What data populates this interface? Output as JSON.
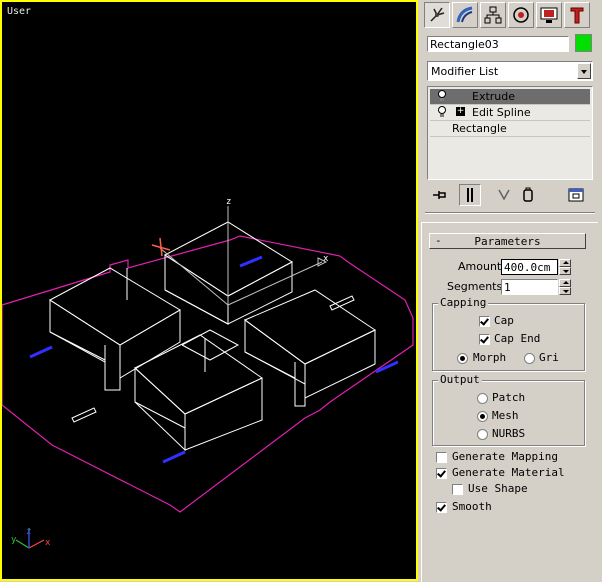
{
  "viewport": {
    "label": "User",
    "axis_labels": {
      "x": "x",
      "y": "y",
      "z": "z"
    },
    "colors": {
      "border": "#ffff00",
      "background": "#000000",
      "wire": "#ffffff",
      "rectangle": "#e020b0",
      "gizmo": "#ff6040"
    }
  },
  "command_panel": {
    "tabs": [
      {
        "name": "create",
        "icon": "create-icon",
        "active": true
      },
      {
        "name": "modify",
        "icon": "modify-icon",
        "active": false
      },
      {
        "name": "hierarchy",
        "icon": "hierarchy-icon",
        "active": false
      },
      {
        "name": "motion",
        "icon": "motion-icon",
        "active": false
      },
      {
        "name": "display",
        "icon": "display-icon",
        "active": false
      },
      {
        "name": "utilities",
        "icon": "utilities-icon",
        "active": false
      }
    ],
    "object_name": "Rectangle03",
    "object_color": "#00e000",
    "modifier_list": "Modifier List",
    "stack": [
      {
        "label": "Extrude",
        "selected": true
      },
      {
        "label": "Edit Spline",
        "selected": false
      },
      {
        "label": "Rectangle",
        "selected": false
      }
    ],
    "stack_tools": [
      "pin-stack-icon",
      "show-end-result-icon",
      "make-unique-icon",
      "remove-modifier-icon",
      "configure-sets-icon"
    ]
  },
  "parameters": {
    "rollout_toggle": "-",
    "title": "Parameters",
    "amount_label": "Amount:",
    "amount_value": "400.0cm",
    "segments_label": "Segments:",
    "segments_value": "1",
    "capping": {
      "title": "Capping",
      "cap_start": "Cap",
      "cap_end": "Cap End",
      "morph": "Morph",
      "grid": "Grid"
    },
    "output": {
      "title": "Output",
      "patch": "Patch",
      "mesh": "Mesh",
      "nurbs": "NURBS"
    },
    "generate_mapping": "Generate Mapping",
    "generate_material": "Generate Material",
    "use_shape": "Use Shape",
    "smooth": "Smooth"
  }
}
